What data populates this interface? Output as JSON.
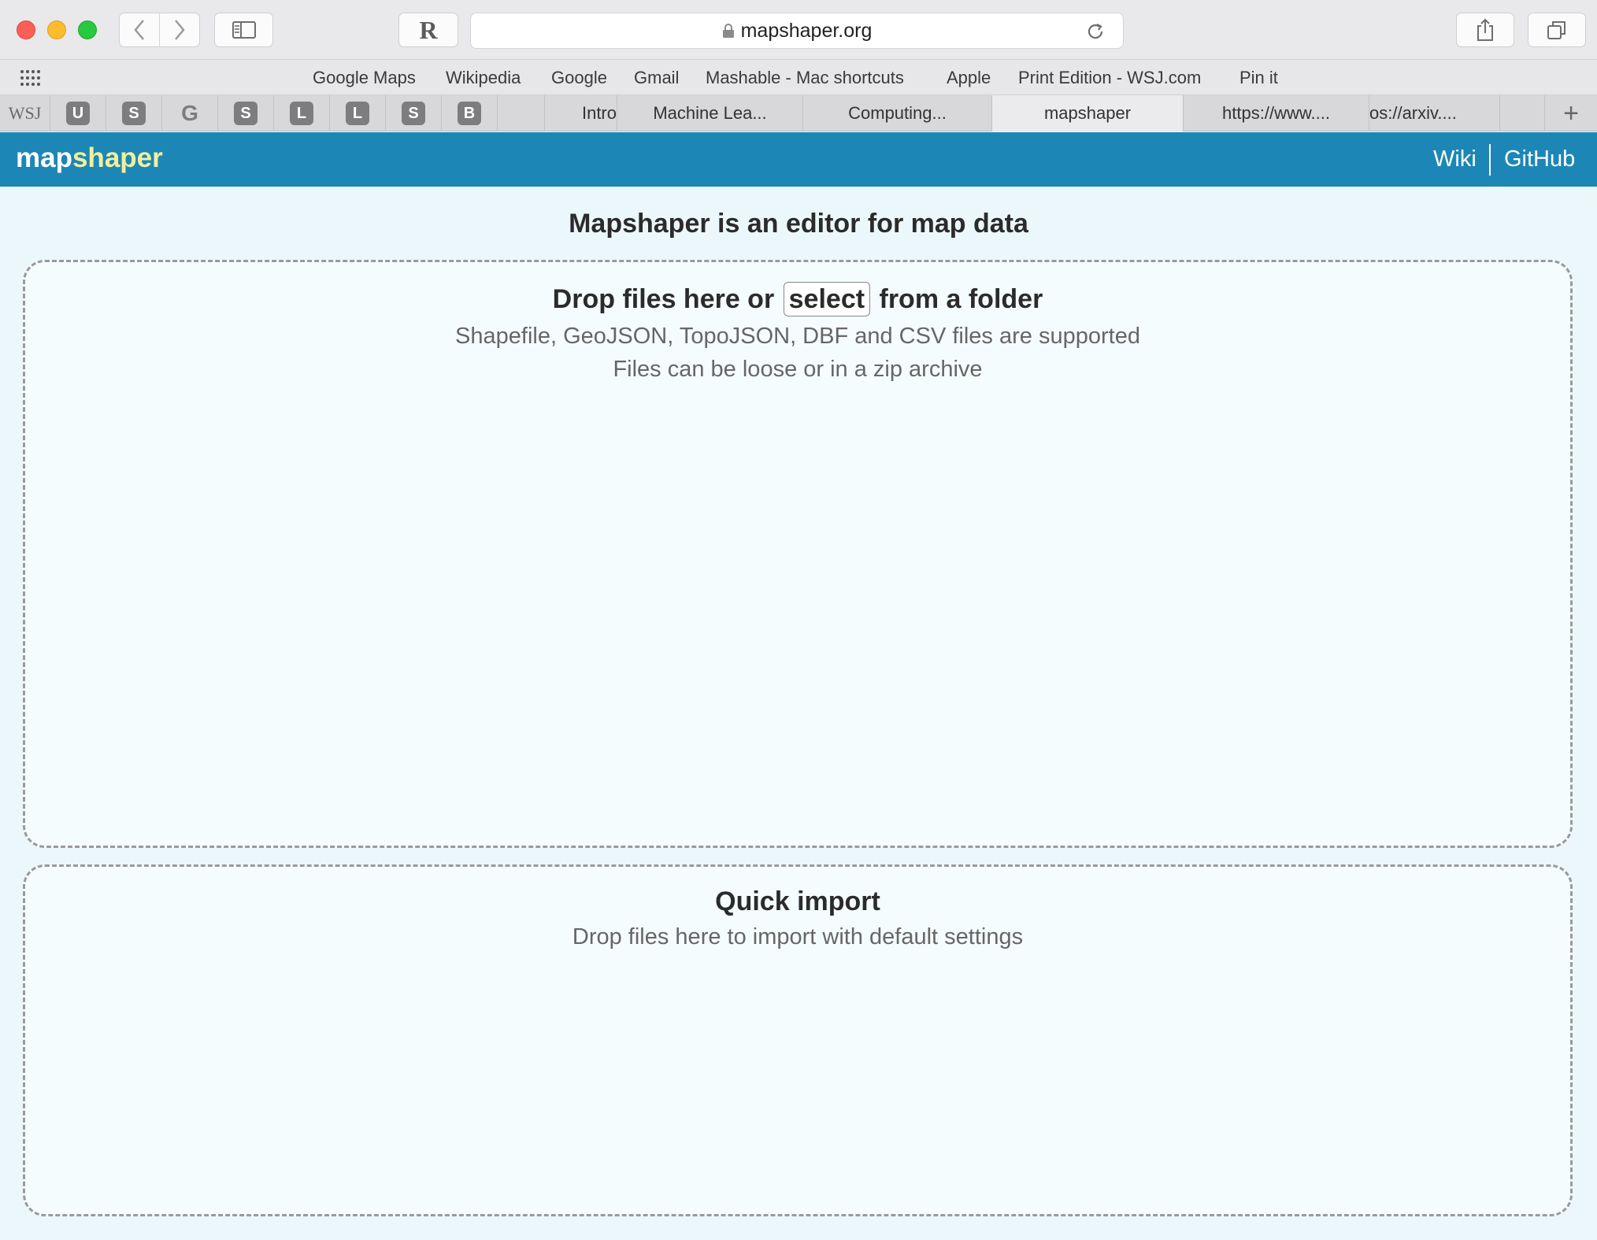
{
  "browser": {
    "url": "mapshaper.org",
    "reader_button": "R",
    "favorites": [
      "Google Maps",
      "Wikipedia",
      "Google",
      "Gmail",
      "Mashable - Mac shortcuts",
      "Apple",
      "Print Edition - WSJ.com",
      "Pin it"
    ],
    "pinned_tabs": [
      "WSJ",
      "U",
      "S",
      "G",
      "S",
      "L",
      "L",
      "S",
      "B"
    ],
    "tabs": [
      {
        "label": "Intro"
      },
      {
        "label": "Machine Lea..."
      },
      {
        "label": "Computing..."
      },
      {
        "label": "mapshaper",
        "active": true
      },
      {
        "label": "https://www...."
      },
      {
        "label": "os://arxiv...."
      }
    ],
    "new_tab_label": "+"
  },
  "app": {
    "logo_part1": "map",
    "logo_part2": "shaper",
    "nav": [
      "Wiki",
      "GitHub"
    ],
    "accent_color": "#1c87b6",
    "logo_accent_color": "#f1ef9e"
  },
  "main": {
    "title": "Mapshaper is an editor for map data",
    "dropzone": {
      "prefix": "Drop files here or",
      "select_label": "select",
      "suffix": "from a folder",
      "line1": "Shapefile, GeoJSON, TopoJSON, DBF and CSV files are supported",
      "line2": "Files can be loose or in a zip archive"
    },
    "quick_import": {
      "title": "Quick import",
      "text": "Drop files here to import with default settings"
    }
  }
}
